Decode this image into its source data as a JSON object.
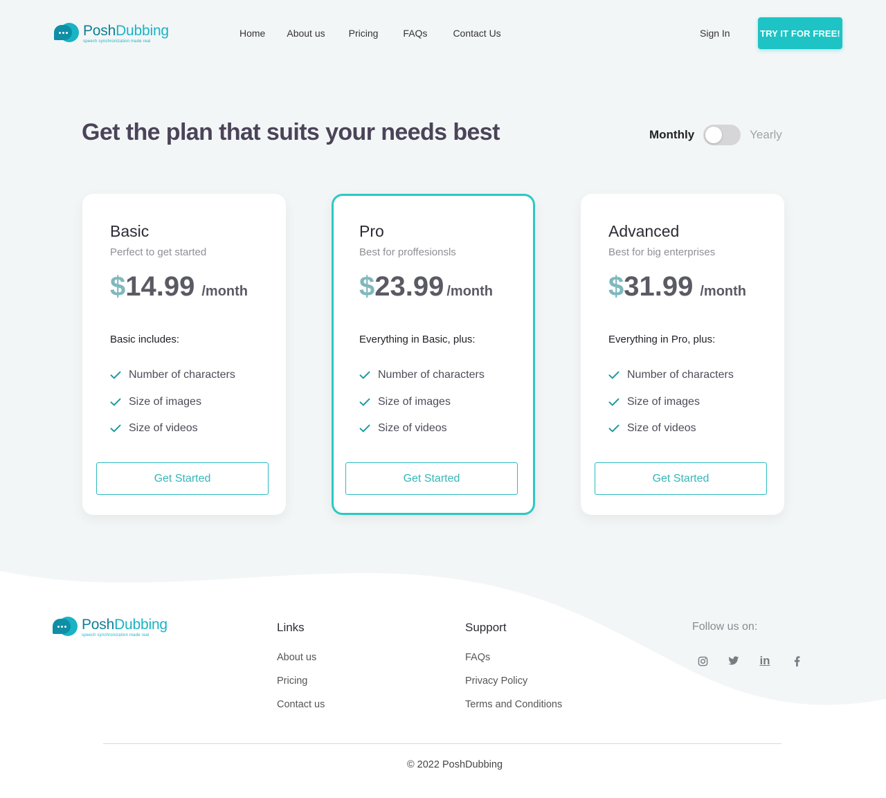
{
  "brand": {
    "name_part1": "Posh",
    "name_part2": "Dubbing",
    "tagline": "speech synchronization made real"
  },
  "nav": {
    "items": [
      "Home",
      "About us",
      "Pricing",
      "FAQs",
      "Contact Us"
    ],
    "signin_label": "Sign In",
    "cta_label": "TRY IT FOR FREE!"
  },
  "hero": {
    "headline": "Get the plan that suits your needs best",
    "billing": {
      "monthly_label": "Monthly",
      "yearly_label": "Yearly",
      "selected": "Monthly"
    }
  },
  "plans": [
    {
      "name": "Basic",
      "subtitle": "Perfect to get started",
      "currency": "$",
      "amount": "14.99",
      "period": "/month",
      "includes_label": "Basic includes:",
      "features": [
        "Number of characters",
        "Size of images",
        "Size of videos"
      ],
      "button_label": "Get Started"
    },
    {
      "name": "Pro",
      "subtitle": "Best for proffesionsls",
      "currency": "$",
      "amount": "23.99",
      "period": "/month",
      "includes_label": "Everything in Basic, plus:",
      "features": [
        "Number of characters",
        "Size of images",
        "Size of videos"
      ],
      "button_label": "Get Started",
      "featured": true
    },
    {
      "name": "Advanced",
      "subtitle": "Best for big enterprises",
      "currency": "$",
      "amount": "31.99",
      "period": "/month",
      "includes_label": "Everything in Pro, plus:",
      "features": [
        "Number of characters",
        "Size of images",
        "Size of videos"
      ],
      "button_label": "Get Started"
    }
  ],
  "footer": {
    "links_title": "Links",
    "links": [
      "About us",
      "Pricing",
      "Contact us"
    ],
    "support_title": "Support",
    "support": [
      "FAQs",
      "Privacy Policy",
      "Terms and Conditions"
    ],
    "follow_label": "Follow us on:",
    "social_icons": [
      "instagram-icon",
      "twitter-icon",
      "linkedin-icon",
      "facebook-icon"
    ],
    "copyright": "© 2022 PoshDubbing"
  },
  "colors": {
    "accent": "#1ec3c5",
    "brand_dark": "#0e7f95",
    "brand_light": "#19b3c4",
    "heading": "#4b4458",
    "background": "#f3f6f7"
  }
}
